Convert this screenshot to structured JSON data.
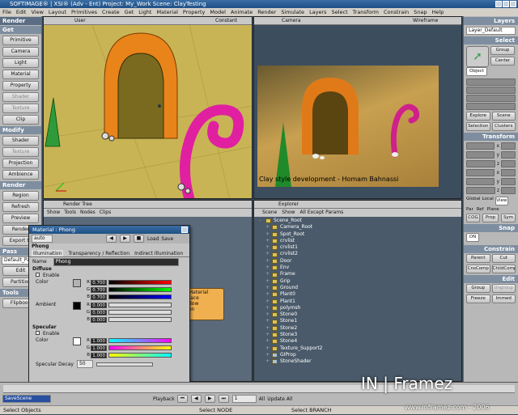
{
  "app": {
    "title": "SOFTIMAGE® | XSI® (Adv - Ent) Project: My_Work   Scene: ClayTesting",
    "menu": [
      "File",
      "Edit",
      "View",
      "Layout",
      "Primitives",
      "Create",
      "Get",
      "Light",
      "Material",
      "Property",
      "Model",
      "Animate",
      "Render",
      "Simulate",
      "Layers",
      "Select",
      "Transform",
      "Constrain",
      "Snap",
      "Help"
    ]
  },
  "left_panel": {
    "tab": "Render",
    "get_header": "Get",
    "get_buttons": [
      "Primitive",
      "Camera",
      "Light",
      "Material",
      "Property",
      "Shader",
      "Texture",
      "Clip"
    ],
    "modify_header": "Modify",
    "modify_buttons": [
      "Shader",
      "Texture",
      "Projection",
      "Ambience"
    ],
    "render_header": "Render",
    "render_buttons": [
      "Region",
      "Refresh",
      "Preview",
      "Render",
      "Export to"
    ],
    "pass_header": "Pass",
    "pass_value": "Default_Pass",
    "pass_buttons": [
      "Edit",
      "Partition"
    ],
    "tools_header": "Tools",
    "tools_buttons": [
      "Flipbook"
    ]
  },
  "viewports": {
    "top_left": {
      "label": "User",
      "shading": "Constant"
    },
    "top_right": {
      "label": "Camera",
      "shading": "Wireframe"
    },
    "render_caption": "Clay style development - Homam Bahnassi",
    "render_tree": {
      "label": "Render Tree",
      "menu": [
        "Show",
        "Tools",
        "Nodes",
        "Clips"
      ],
      "node_title": "Material",
      "node_ports": [
        "face",
        "dow",
        "on"
      ]
    },
    "explorer": {
      "label": "Explorer",
      "menu": [
        "Scene",
        "Show",
        "All Except Params"
      ],
      "items": [
        "Scene_Root",
        "Camera_Root",
        "Spot_Root",
        "crvlist",
        "crvlist1",
        "crvlist2",
        "Door",
        "Env",
        "Frame",
        "Grip",
        "Ground",
        "Plant0",
        "Plant1",
        "polymsh",
        "Stone0",
        "Stone1",
        "Stone2",
        "Stone3",
        "Stone4",
        "Texture_Support2",
        "GIProp",
        "StoneShader"
      ]
    }
  },
  "property_editor": {
    "title": "Material : Phong",
    "auto_label": "auto",
    "load_label": "Load",
    "save_label": "Save",
    "shader_name": "Phong",
    "tabs": [
      "Illumination",
      "Transparency / Reflection",
      "Indirect Illumination"
    ],
    "name_label": "Name",
    "name_value": "Phong",
    "diffuse": {
      "header": "Diffuse",
      "enable": "Enable",
      "color_label": "Color",
      "r": "0.700",
      "g": "0.700",
      "b": "0.700",
      "rgb": "RGB"
    },
    "ambient": {
      "label": "Ambient",
      "r": "0.000",
      "g": "0.000",
      "b": "0.000",
      "rgb": "RGB"
    },
    "specular": {
      "header": "Specular",
      "enable": "Enable",
      "color_label": "Color",
      "r": "1.000",
      "g": "1.000",
      "b": "1.000",
      "rgb": "RGB",
      "decay_label": "Specular Decay",
      "decay_value": "50"
    }
  },
  "right_panel": {
    "layers_header": "Layers",
    "layer_value": "Layer_Default",
    "select_header": "Select",
    "group": "Group",
    "center": "Center",
    "object": "Object",
    "explore": "Explore",
    "scene": "Scene",
    "selection": "Selection",
    "clusters": "Clusters",
    "transform_header": "Transform",
    "axes": [
      "x",
      "y",
      "z"
    ],
    "global": "Global",
    "local": "Local",
    "view": "View",
    "par": "Par",
    "ref": "Ref",
    "plane": "Plane",
    "cog": "COG",
    "prop": "Prop",
    "sym": "Sym",
    "snap_header": "Snap",
    "snap_on": "ON",
    "constrain_header": "Constrain",
    "parent": "Parent",
    "cut": "Cut",
    "cnscomp": "CnsComp",
    "childcomp": "ChildComp",
    "edit_header": "Edit",
    "edit_group": "Group",
    "ungroup": "Ungroup",
    "freeze": "Freeze",
    "immed": "Immed"
  },
  "bottom": {
    "scene_name": "SaveScene",
    "playback": "Playback",
    "frame_value": "1",
    "all": "All",
    "update": "Update All",
    "status": [
      "Select Objects",
      "Select NODE",
      "Select BRANCH"
    ],
    "watermark_brand": "IN | Framez",
    "watermark_url": "www.inframez.com - 2006"
  },
  "colors": {
    "titlebar": "#2a5c96",
    "orange_clay": "#e8841a",
    "pink_clay": "#e020a0",
    "green_clay": "#2e9a3a",
    "panel": "#b8b8b8"
  }
}
